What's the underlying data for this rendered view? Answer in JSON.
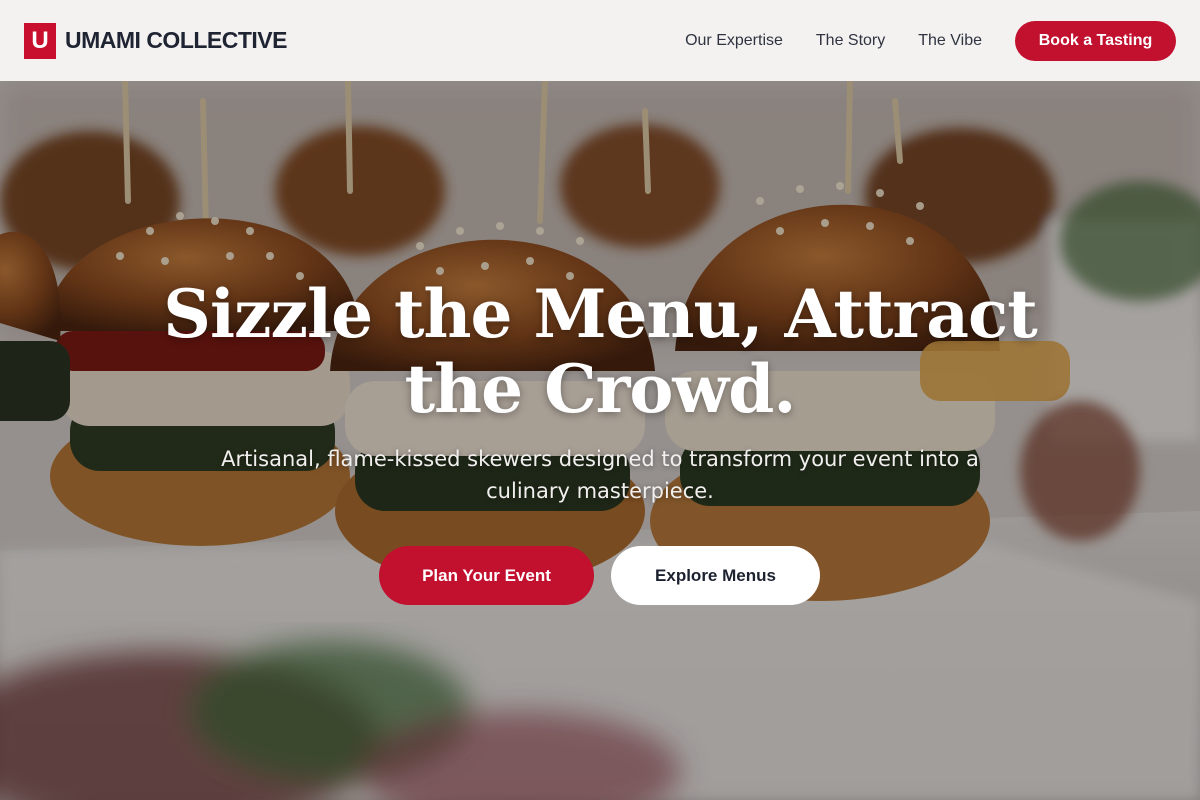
{
  "brand": {
    "logo_letter": "U",
    "name": "UMAMI COLLECTIVE",
    "accent_color": "#c8102e"
  },
  "nav": {
    "items": [
      {
        "label": "Our Expertise"
      },
      {
        "label": "The Story"
      },
      {
        "label": "The Vibe"
      }
    ],
    "cta_label": "Book a Tasting"
  },
  "hero": {
    "title": "Sizzle the Menu, Attract the Crowd.",
    "subtitle": "Artisanal, flame-kissed skewers designed to transform your event into a culinary masterpiece.",
    "primary_button": "Plan Your Event",
    "secondary_button": "Explore Menus",
    "image_subject": "slider burgers with skewers on a platter"
  }
}
